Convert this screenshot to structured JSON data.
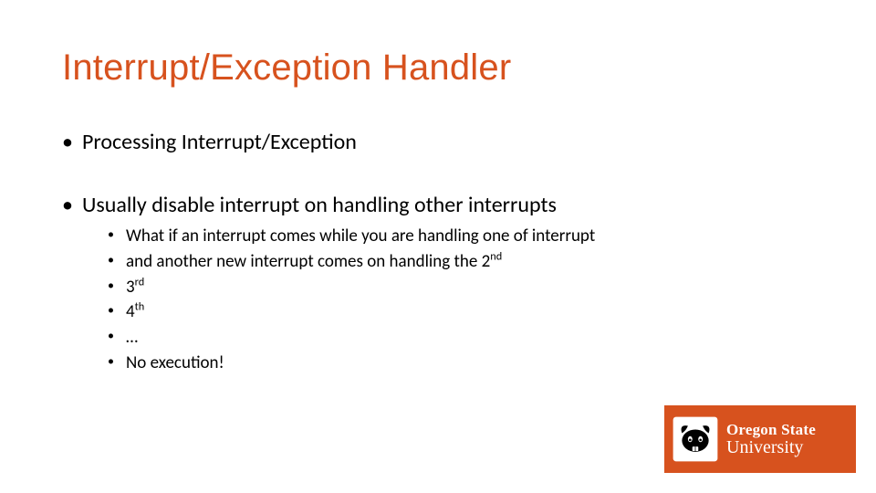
{
  "title": "Interrupt/Exception Handler",
  "bullets_l1": {
    "0": "Processing Interrupt/Exception",
    "1": "Usually disable interrupt on handling other interrupts"
  },
  "bullets_l2": {
    "0": "What if an interrupt comes while you are handling one of interrupt",
    "1_pre": "and another new interrupt comes on handling the 2",
    "1_sup": "nd",
    "2_pre": "3",
    "2_sup": "rd",
    "3_pre": "4",
    "3_sup": "th",
    "4": "…",
    "5": "No execution!"
  },
  "logo": {
    "line1": "Oregon State",
    "line2": "University"
  },
  "colors": {
    "accent": "#D7521E"
  }
}
